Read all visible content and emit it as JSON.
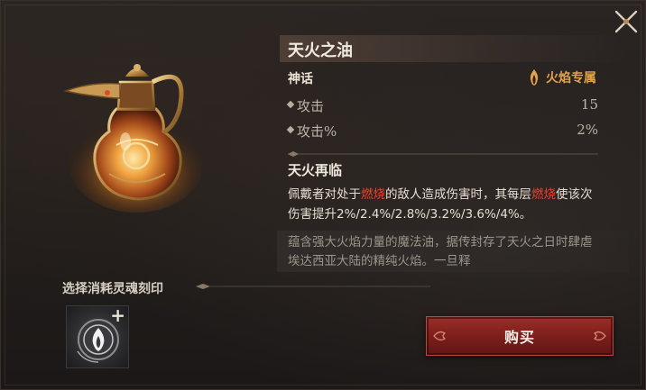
{
  "item": {
    "name": "天火之油",
    "rarity": "神话",
    "tag": "火焰专属"
  },
  "stats": [
    {
      "name": "攻击",
      "value": "15"
    },
    {
      "name": "攻击%",
      "value": "2%"
    }
  ],
  "skill": {
    "name": "天火再临",
    "desc_1": "佩戴者对处于",
    "desc_hl_1": "燃烧",
    "desc_2": "的敌人造成伤害时，其每层",
    "desc_hl_2": "燃烧",
    "desc_3": "使该次伤害提升2%/2.4%/2.8%/3.2%/3.6%/4%。"
  },
  "flavor": "蕴含强大火焰力量的魔法油，据传封存了天火之日时肆虐埃达西亚大陆的精纯火焰。一旦释",
  "soul_section": {
    "label": "选择消耗灵魂刻印",
    "plus": "+"
  },
  "buy_button": "购买",
  "colors": {
    "accent_orange": "#e2a14a",
    "highlight_red": "#e8442e",
    "button_red": "#7d1f1c"
  },
  "icons": {
    "close": "close-x-icon",
    "tag": "flame-icon",
    "slot": "soul-seal-icon"
  }
}
